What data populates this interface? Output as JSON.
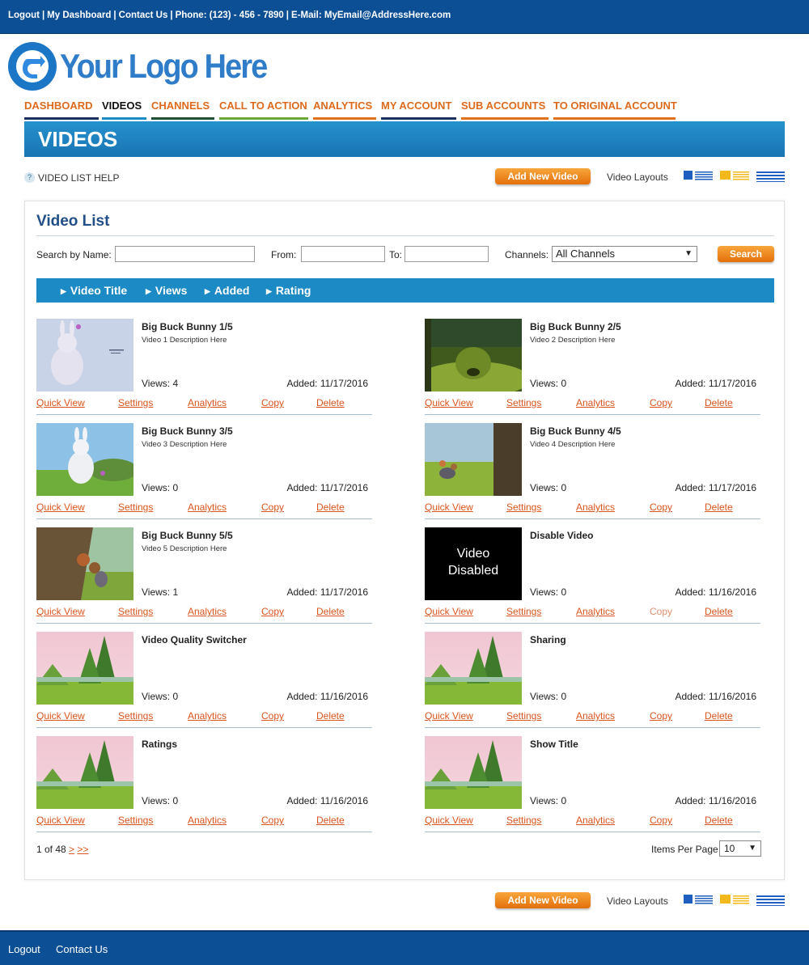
{
  "topbar": {
    "logout": "Logout",
    "dashboard": "My Dashboard",
    "contact": "Contact Us",
    "phone": "Phone: (123) - 456 - 7890",
    "email": "E-Mail: MyEmail@AddressHere.com"
  },
  "logo": {
    "text": "Your Logo Here"
  },
  "nav": [
    {
      "label": "DASHBOARD",
      "color": "#1b2f5c"
    },
    {
      "label": "VIDEOS",
      "color": "#1c8ac5",
      "active": true
    },
    {
      "label": "CHANNELS",
      "color": "#1e4f32"
    },
    {
      "label": "CALL TO ACTION",
      "color": "#6aa83a"
    },
    {
      "label": "ANALYTICS",
      "color": "#e0711f"
    },
    {
      "label": "MY ACCOUNT",
      "color": "#1b2f5c"
    },
    {
      "label": "SUB ACCOUNTS",
      "color": "#e0711f"
    },
    {
      "label": "TO ORIGINAL ACCOUNT",
      "color": "#e0711f"
    }
  ],
  "banner": {
    "title": "VIDEOS"
  },
  "toolbar": {
    "help": "VIDEO LIST HELP",
    "add_new": "Add New Video",
    "layouts": "Video Layouts"
  },
  "panel": {
    "title": "Video List"
  },
  "search": {
    "by_name": "Search by Name:",
    "from": "From:",
    "to": "To:",
    "channels": "Channels:",
    "channels_value": "All Channels",
    "button": "Search"
  },
  "sort": [
    "Video Title",
    "Views",
    "Added",
    "Rating"
  ],
  "actions": [
    "Quick View",
    "Settings",
    "Analytics",
    "Copy",
    "Delete"
  ],
  "videos": [
    {
      "title": "Big Buck Bunny 1/5",
      "desc": "Video 1 Description Here",
      "views": "Views: 4",
      "added": "Added: 11/17/2016",
      "thumb": "bunny1"
    },
    {
      "title": "Big Buck Bunny 2/5",
      "desc": "Video 2 Description Here",
      "views": "Views: 0",
      "added": "Added: 11/17/2016",
      "thumb": "bunny2"
    },
    {
      "title": "Big Buck Bunny 3/5",
      "desc": "Video 3 Description Here",
      "views": "Views: 0",
      "added": "Added: 11/17/2016",
      "thumb": "bunny3"
    },
    {
      "title": "Big Buck Bunny 4/5",
      "desc": "Video 4 Description Here",
      "views": "Views: 0",
      "added": "Added: 11/17/2016",
      "thumb": "bunny4"
    },
    {
      "title": "Big Buck Bunny 5/5",
      "desc": "Video 5 Description Here",
      "views": "Views: 1",
      "added": "Added: 11/17/2016",
      "thumb": "bunny5"
    },
    {
      "title": "Disable Video",
      "desc": "",
      "views": "Views: 0",
      "added": "Added: 11/16/2016",
      "thumb": "disabled",
      "thumb_text_1": "Video",
      "thumb_text_2": "Disabled",
      "copy_disabled": true
    },
    {
      "title": "Video Quality Switcher",
      "desc": "",
      "views": "Views: 0",
      "added": "Added: 11/16/2016",
      "thumb": "forest"
    },
    {
      "title": "Sharing",
      "desc": "",
      "views": "Views: 0",
      "added": "Added: 11/16/2016",
      "thumb": "forest"
    },
    {
      "title": "Ratings",
      "desc": "",
      "views": "Views: 0",
      "added": "Added: 11/16/2016",
      "thumb": "forest"
    },
    {
      "title": "Show Title",
      "desc": "",
      "views": "Views: 0",
      "added": "Added: 11/16/2016",
      "thumb": "forest"
    }
  ],
  "pager": {
    "text": "1 of 48",
    "next": ">",
    "last": ">>"
  },
  "items_per_page": {
    "label": "Items Per Page",
    "value": "10"
  },
  "footer": {
    "logout": "Logout",
    "contact": "Contact Us"
  },
  "colors": {
    "primary": "#0d4f95",
    "accent": "#e46f09",
    "link": "#d9541e",
    "sortbar": "#1c8ac5"
  }
}
